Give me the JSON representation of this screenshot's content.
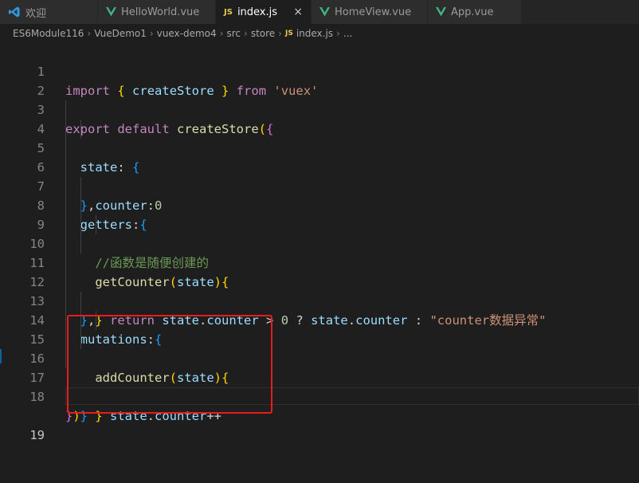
{
  "tabs": [
    {
      "label": "欢迎",
      "icon": "vscode-logo-icon",
      "active": false
    },
    {
      "label": "HelloWorld.vue",
      "icon": "vue-icon",
      "active": false
    },
    {
      "label": "index.js",
      "icon": "js-icon",
      "icon_text": "JS",
      "active": true,
      "close": "×"
    },
    {
      "label": "HomeView.vue",
      "icon": "vue-icon",
      "active": false
    },
    {
      "label": "App.vue",
      "icon": "vue-icon",
      "active": false
    }
  ],
  "breadcrumb": {
    "items": [
      "ES6Module116",
      "VueDemo1",
      "vuex-demo4",
      "src",
      "store",
      "index.js",
      "..."
    ],
    "separator": "›",
    "file_icon_text": "JS"
  },
  "editor": {
    "line_numbers": [
      "1",
      "2",
      "3",
      "4",
      "5",
      "6",
      "7",
      "8",
      "9",
      "10",
      "11",
      "12",
      "13",
      "14",
      "15",
      "16",
      "17",
      "18",
      "19"
    ],
    "current_line": "19",
    "code": {
      "l1": {
        "kw_import": "import",
        "b_open": "{",
        "name": "createStore",
        "b_close": "}",
        "kw_from": "from",
        "str": "'vuex'"
      },
      "l3": {
        "kw_export": "export",
        "kw_default": "default",
        "fn": "createStore",
        "paren": "(",
        "brace": "{"
      },
      "l4": {
        "prop": "state",
        "colon": ":",
        "brace": "{"
      },
      "l5": {
        "prop": "counter",
        "colon": ":",
        "num": "0"
      },
      "l6": {
        "brace": "}",
        "comma": ","
      },
      "l7": {
        "prop": "getters",
        "colon": ":",
        "brace": "{"
      },
      "l8": {
        "comment": "//函数是随便创建的"
      },
      "l9": {
        "fn": "getCounter",
        "paren_open": "(",
        "param": "state",
        "paren_close": ")",
        "brace": "{"
      },
      "l10": {
        "kw": "return",
        "obj1": "state",
        "dot1": ".",
        "prop1": "counter",
        "op1": ">",
        "num": "0",
        "op2": "?",
        "obj2": "state",
        "dot2": ".",
        "prop2": "counter",
        "op3": ":",
        "str": "\"counter数据异常\""
      },
      "l11": {
        "brace": "}"
      },
      "l12": {
        "brace": "}",
        "comma": ","
      },
      "l13": {
        "prop": "mutations",
        "colon": ":",
        "brace": "{"
      },
      "l14": {
        "fn": "addCounter",
        "paren_open": "(",
        "param": "state",
        "paren_close": ")",
        "brace": "{"
      },
      "l15": {
        "obj": "state",
        "dot": ".",
        "prop": "counter",
        "op": "++"
      },
      "l16": {
        "brace": "}"
      },
      "l17": {
        "brace": "}"
      },
      "l18": {
        "brace": "}",
        "paren": ")"
      }
    }
  },
  "colors": {
    "keyword": "#c586c0",
    "storage": "#569cd6",
    "function": "#dcdcaa",
    "variable": "#9cdcfe",
    "string": "#ce9178",
    "number": "#b5cea8",
    "comment": "#6a9955",
    "bracket_gold": "#ffd700",
    "bracket_orchid": "#da70d6",
    "bracket_blue": "#179fff",
    "selection_box": "#e81c1c",
    "editor_bg": "#1e1e1e"
  }
}
